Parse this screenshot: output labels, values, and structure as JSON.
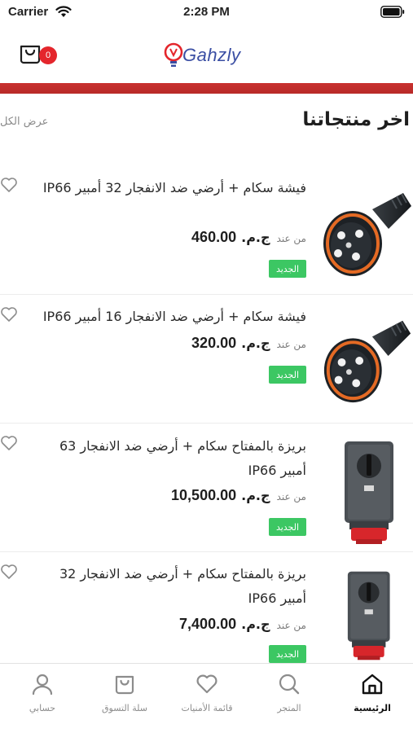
{
  "status_bar": {
    "carrier": "Carrier",
    "time": "2:28 PM"
  },
  "header": {
    "cart_count": "0",
    "logo_text": "Gahzly"
  },
  "section": {
    "title": "اخر منتجاتنا",
    "view_all": "عرض الكل"
  },
  "products": [
    {
      "name": "فيشة سكام + أرضي ضد الانفجار 32 أمبير IP66",
      "price_from": "من عند",
      "currency": "ج.م.",
      "price": "460.00",
      "badge": "الجديد",
      "image": "plug-icon"
    },
    {
      "name": "فيشة سكام + أرضي ضد الانفجار 16 أمبير IP66",
      "price_from": "من عند",
      "currency": "ج.م.",
      "price": "320.00",
      "badge": "الجديد",
      "image": "plug-icon"
    },
    {
      "name": "بريزة بالمفتاح سكام + أرضي ضد الانفجار 63 أمبير IP66",
      "price_from": "من عند",
      "currency": "ج.م.",
      "price": "10,500.00",
      "badge": "الجديد",
      "image": "switched-socket-icon"
    },
    {
      "name": "بريزة بالمفتاح سكام + أرضي ضد الانفجار 32 أمبير IP66",
      "price_from": "من عند",
      "currency": "ج.م.",
      "price": "7,400.00",
      "badge": "الجديد",
      "image": "switched-socket-icon"
    }
  ],
  "tabs": [
    {
      "label": "الرئيسية",
      "icon": "home-icon",
      "active": true
    },
    {
      "label": "المتجر",
      "icon": "search-icon",
      "active": false
    },
    {
      "label": "قائمة الأمنيات",
      "icon": "heart-icon",
      "active": false
    },
    {
      "label": "سلة التسوق",
      "icon": "bag-icon",
      "active": false
    },
    {
      "label": "حسابي",
      "icon": "person-icon",
      "active": false
    }
  ],
  "colors": {
    "brand_red": "#c9312f",
    "badge_green": "#3cc763",
    "logo_blue": "#3a4ea3",
    "cart_badge": "#e4262c"
  }
}
